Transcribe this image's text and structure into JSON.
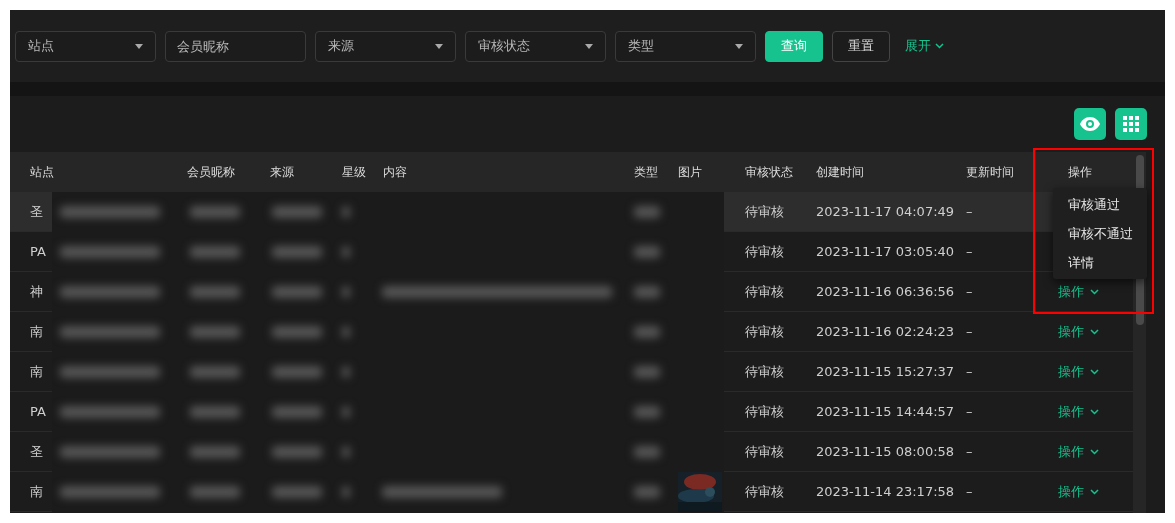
{
  "filters": [
    {
      "kind": "select",
      "placeholder": "站点"
    },
    {
      "kind": "input",
      "placeholder": "会员昵称"
    },
    {
      "kind": "select",
      "placeholder": "来源"
    },
    {
      "kind": "select",
      "placeholder": "审核状态"
    },
    {
      "kind": "select",
      "placeholder": "类型"
    }
  ],
  "buttons": [
    {
      "kind": "primary",
      "label": "查询"
    },
    {
      "kind": "default",
      "label": "重置"
    }
  ],
  "expand": {
    "label": "展开"
  },
  "table": {
    "columns": [
      "站点",
      "会员昵称",
      "来源",
      "星级",
      "内容",
      "类型",
      "图片",
      "审核状态",
      "创建时间",
      "更新时间",
      "操作"
    ],
    "rows": [
      {
        "site": "圣",
        "status": "待审核",
        "created": "2023-11-17 04:07:49",
        "updated": "–",
        "hovered": true
      },
      {
        "site": "PA",
        "status": "待审核",
        "created": "2023-11-17 03:05:40",
        "updated": "–",
        "hovered": false
      },
      {
        "site": "神",
        "status": "待审核",
        "created": "2023-11-16 06:36:56",
        "updated": "–",
        "hovered": false,
        "action": "操作"
      },
      {
        "site": "南",
        "status": "待审核",
        "created": "2023-11-16 02:24:23",
        "updated": "–",
        "hovered": false,
        "action": "操作"
      },
      {
        "site": "南",
        "status": "待审核",
        "created": "2023-11-15 15:27:37",
        "updated": "–",
        "hovered": false,
        "action": "操作"
      },
      {
        "site": "PA",
        "status": "待审核",
        "created": "2023-11-15 14:44:57",
        "updated": "–",
        "hovered": false,
        "action": "操作"
      },
      {
        "site": "圣",
        "status": "待审核",
        "created": "2023-11-15 08:00:58",
        "updated": "–",
        "hovered": false,
        "action": "操作"
      },
      {
        "site": "南",
        "status": "待审核",
        "created": "2023-11-14 23:17:58",
        "updated": "–",
        "hovered": false,
        "action": "操作"
      }
    ]
  },
  "action_menu": {
    "items": [
      "审核通过",
      "审核不通过",
      "详情"
    ]
  }
}
